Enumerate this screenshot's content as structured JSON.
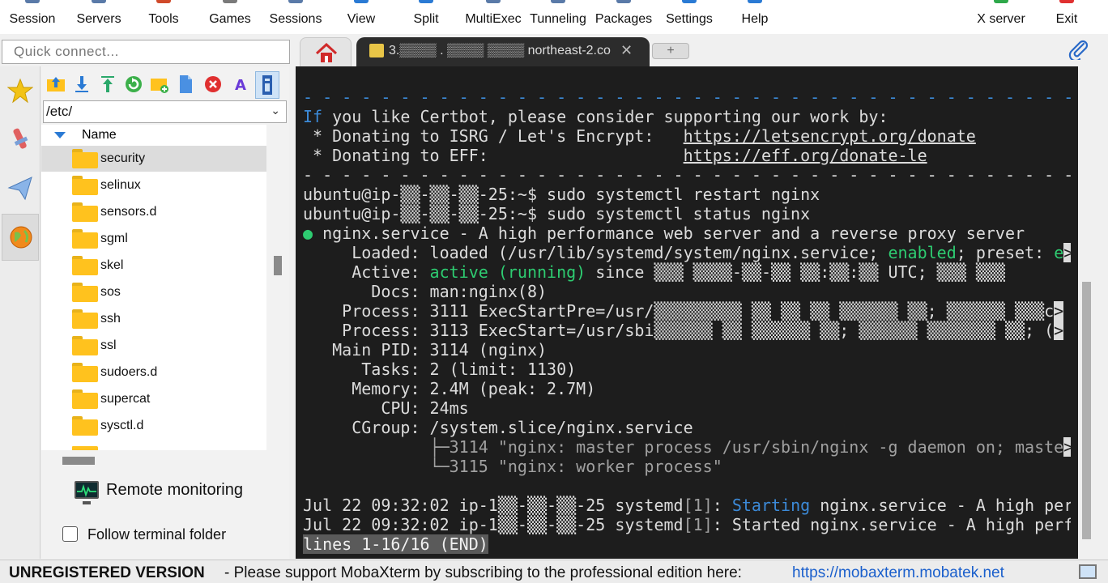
{
  "toolbar": {
    "items": [
      "Session",
      "Servers",
      "Tools",
      "Games",
      "Sessions",
      "View",
      "Split",
      "MultiExec",
      "Tunneling",
      "Packages",
      "Settings",
      "Help"
    ],
    "right_items": [
      "X server",
      "Exit"
    ]
  },
  "quick_connect": {
    "placeholder": "Quick connect..."
  },
  "sftp": {
    "path": "/etc/",
    "column_header": "Name",
    "items": [
      "security",
      "selinux",
      "sensors.d",
      "sgml",
      "skel",
      "sos",
      "ssh",
      "ssl",
      "sudoers.d",
      "supercat",
      "sysctl.d"
    ],
    "selected": "security"
  },
  "side_panel": {
    "remote_monitoring": "Remote monitoring",
    "follow_terminal_folder": "Follow terminal folder",
    "follow_checked": false
  },
  "tabs": {
    "active_title": "3.▒▒▒▒ . ▒▒▒▒ ▒▒▒▒ northeast-2.co",
    "close": "✕",
    "new": "+"
  },
  "terminal": {
    "sep": "- - - - - - - - - - - - - - - - - - - - - - - - - - - - - - - - - - - - - - - -",
    "certbot_if": "If",
    "certbot_rest": " you like Certbot, please consider supporting our work by:",
    "donate1_pre": " * Donating to ISRG / Let's Encrypt:   ",
    "donate1_link": "https://letsencrypt.org/donate",
    "donate2_pre": " * Donating to EFF:                    ",
    "donate2_link": "https://eff.org/donate-le",
    "prompt1": "ubuntu@ip-▒▒-▒▒-▒▒-25:~$ sudo systemctl restart nginx",
    "prompt2": "ubuntu@ip-▒▒-▒▒-▒▒-25:~$ sudo systemctl status nginx",
    "svc_dot": "●",
    "svc": " nginx.service - A high performance web server and a reverse proxy server",
    "loaded_pre": "     Loaded: loaded (/usr/lib/systemd/system/nginx.service; ",
    "loaded_enabled": "enabled",
    "loaded_post": "; preset: ",
    "loaded_e": "e",
    "gt": ">",
    "active_pre": "     Active: ",
    "active_state": "active (running)",
    "active_post": " since ▒▒▒ ▒▒▒▒-▒▒-▒▒ ▒▒:▒▒:▒▒ UTC; ▒▒▒ ▒▒▒",
    "docs": "       Docs: man:nginx(8)",
    "process1": "    Process: 3111 ExecStartPre=/usr/▒▒▒▒▒▒▒▒▒ ▒▒ ▒▒ ▒▒ ▒▒▒▒▒▒ ▒▒; ▒▒▒▒▒▒ ▒▒▒c",
    "process2": "    Process: 3113 ExecStart=/usr/sbi▒▒▒▒▒▒ ▒▒ ▒▒▒▒▒▒ ▒▒; ▒▒▒▒▒▒ ▒▒▒▒▒▒▒ ▒▒; (",
    "mainpid": "   Main PID: 3114 (nginx)",
    "tasks": "      Tasks: 2 (limit: 1130)",
    "memory": "     Memory: 2.4M (peak: 2.7M)",
    "cpu": "        CPU: 24ms",
    "cgroup": "     CGroup: /system.slice/nginx.service",
    "cg1": "             ├─3114 \"nginx: master process /usr/sbin/nginx -g daemon on; maste",
    "cg2": "             └─3115 \"nginx: worker process\"",
    "log1_pre": "Jul 22 09:32:02 ip-1▒▒-▒▒-▒▒-25 systemd",
    "log_bracket": "[1]",
    "log1_colon": ": ",
    "log1_starting": "Starting",
    "log1_post": " nginx.service - A high per",
    "log2_post": ": Started nginx.service - A high perf",
    "end": "lines 1-16/16 (END)"
  },
  "status_bar": {
    "unregistered": "UNREGISTERED VERSION",
    "message": "-  Please support MobaXterm by subscribing to the professional edition here:",
    "link": "https://mobaxterm.mobatek.net"
  },
  "colors": {
    "terminal_bg": "#1d1d1d",
    "terminal_fg": "#dcdcdc",
    "accent_blue": "#3c8ad8",
    "status_green": "#2ecc71",
    "folder": "#ffc21e"
  }
}
